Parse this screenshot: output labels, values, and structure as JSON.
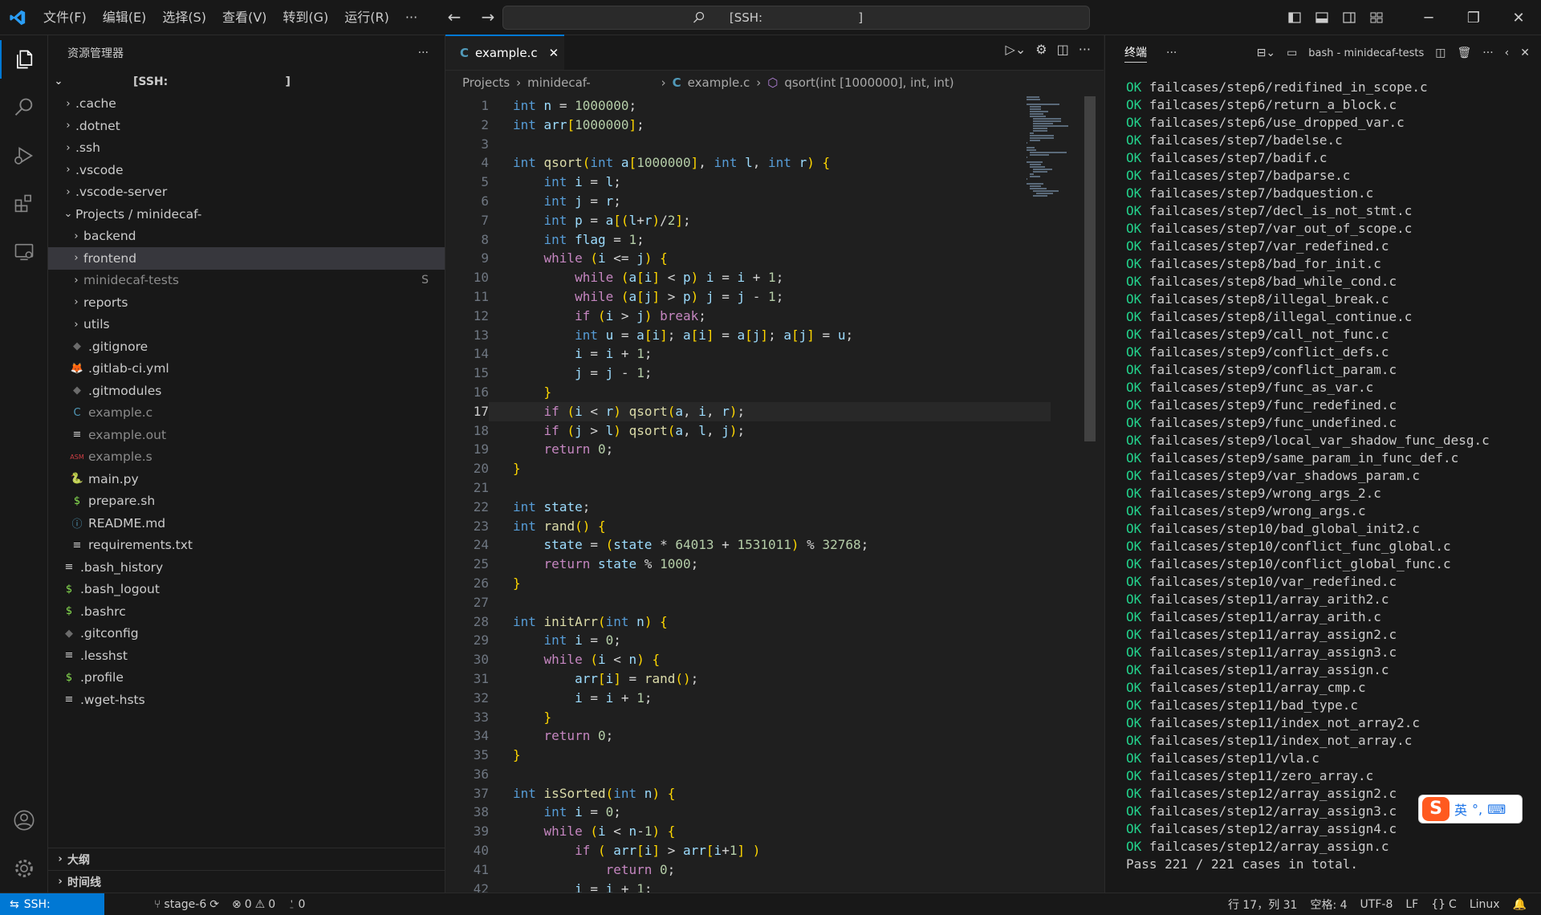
{
  "menu": [
    "文件(F)",
    "编辑(E)",
    "选择(S)",
    "查看(V)",
    "转到(G)",
    "运行(R)",
    "···"
  ],
  "command_center": "[SSH:                         ]",
  "sidebar": {
    "title": "资源管理器",
    "root": "[SSH:                              ]",
    "items": [
      {
        "label": ".cache",
        "kind": "folder",
        "depth": 1
      },
      {
        "label": ".dotnet",
        "kind": "folder",
        "depth": 1
      },
      {
        "label": ".ssh",
        "kind": "folder",
        "depth": 1
      },
      {
        "label": ".vscode",
        "kind": "folder",
        "depth": 1
      },
      {
        "label": ".vscode-server",
        "kind": "folder",
        "depth": 1
      },
      {
        "label": "Projects / minidecaf-",
        "kind": "folder-open",
        "depth": 1
      },
      {
        "label": "backend",
        "kind": "folder",
        "depth": 2
      },
      {
        "label": "frontend",
        "kind": "folder",
        "depth": 2,
        "selected": true
      },
      {
        "label": "minidecaf-tests",
        "kind": "folder",
        "depth": 2,
        "dim": true,
        "badge": "S"
      },
      {
        "label": "reports",
        "kind": "folder",
        "depth": 2
      },
      {
        "label": "utils",
        "kind": "folder",
        "depth": 2
      },
      {
        "label": ".gitignore",
        "kind": "git",
        "depth": 2
      },
      {
        "label": ".gitlab-ci.yml",
        "kind": "gitlab",
        "depth": 2
      },
      {
        "label": ".gitmodules",
        "kind": "git",
        "depth": 2
      },
      {
        "label": "example.c",
        "kind": "c",
        "depth": 2,
        "dim": true
      },
      {
        "label": "example.out",
        "kind": "lines",
        "depth": 2,
        "dim": true
      },
      {
        "label": "example.s",
        "kind": "asm",
        "depth": 2,
        "dim": true
      },
      {
        "label": "main.py",
        "kind": "py",
        "depth": 2
      },
      {
        "label": "prepare.sh",
        "kind": "sh",
        "depth": 2
      },
      {
        "label": "README.md",
        "kind": "info",
        "depth": 2
      },
      {
        "label": "requirements.txt",
        "kind": "lines",
        "depth": 2
      },
      {
        "label": ".bash_history",
        "kind": "lines",
        "depth": 1
      },
      {
        "label": ".bash_logout",
        "kind": "sh",
        "depth": 1
      },
      {
        "label": ".bashrc",
        "kind": "sh",
        "depth": 1
      },
      {
        "label": ".gitconfig",
        "kind": "git",
        "depth": 1
      },
      {
        "label": ".lesshst",
        "kind": "lines",
        "depth": 1
      },
      {
        "label": ".profile",
        "kind": "sh",
        "depth": 1
      },
      {
        "label": ".wget-hsts",
        "kind": "lines",
        "depth": 1
      }
    ],
    "sections": [
      "大纲",
      "时间线"
    ]
  },
  "editor": {
    "tab": "example.c",
    "breadcrumb": [
      "Projects",
      "minidecaf-",
      "example.c",
      "qsort(int [1000000], int, int)"
    ],
    "current_line": 17,
    "lines": [
      "int n = 1000000;",
      "int arr[1000000];",
      "",
      "int qsort(int a[1000000], int l, int r) {",
      "    int i = l;",
      "    int j = r;",
      "    int p = a[(l+r)/2];",
      "    int flag = 1;",
      "    while (i <= j) {",
      "        while (a[i] < p) i = i + 1;",
      "        while (a[j] > p) j = j - 1;",
      "        if (i > j) break;",
      "        int u = a[i]; a[i] = a[j]; a[j] = u;",
      "        i = i + 1;",
      "        j = j - 1;",
      "    }",
      "    if (i < r) qsort(a, i, r);",
      "    if (j > l) qsort(a, l, j);",
      "    return 0;",
      "}",
      "",
      "int state;",
      "int rand() {",
      "    state = (state * 64013 + 1531011) % 32768;",
      "    return state % 1000;",
      "}",
      "",
      "int initArr(int n) {",
      "    int i = 0;",
      "    while (i < n) {",
      "        arr[i] = rand();",
      "        i = i + 1;",
      "    }",
      "    return 0;",
      "}",
      "",
      "int isSorted(int n) {",
      "    int i = 0;",
      "    while (i < n-1) {",
      "        if ( arr[i] > arr[i+1] )",
      "            return 0;",
      "        i = i + 1;"
    ]
  },
  "panel": {
    "tab": "终端",
    "terminal_name": "bash - minidecaf-tests",
    "lines": [
      "failcases/step6/redifined_in_scope.c",
      "failcases/step6/return_a_block.c",
      "failcases/step6/use_dropped_var.c",
      "failcases/step7/badelse.c",
      "failcases/step7/badif.c",
      "failcases/step7/badparse.c",
      "failcases/step7/badquestion.c",
      "failcases/step7/decl_is_not_stmt.c",
      "failcases/step7/var_out_of_scope.c",
      "failcases/step7/var_redefined.c",
      "failcases/step8/bad_for_init.c",
      "failcases/step8/bad_while_cond.c",
      "failcases/step8/illegal_break.c",
      "failcases/step8/illegal_continue.c",
      "failcases/step9/call_not_func.c",
      "failcases/step9/conflict_defs.c",
      "failcases/step9/conflict_param.c",
      "failcases/step9/func_as_var.c",
      "failcases/step9/func_redefined.c",
      "failcases/step9/func_undefined.c",
      "failcases/step9/local_var_shadow_func_desg.c",
      "failcases/step9/same_param_in_func_def.c",
      "failcases/step9/var_shadows_param.c",
      "failcases/step9/wrong_args_2.c",
      "failcases/step9/wrong_args.c",
      "failcases/step10/bad_global_init2.c",
      "failcases/step10/conflict_func_global.c",
      "failcases/step10/conflict_global_func.c",
      "failcases/step10/var_redefined.c",
      "failcases/step11/array_arith2.c",
      "failcases/step11/array_arith.c",
      "failcases/step11/array_assign2.c",
      "failcases/step11/array_assign3.c",
      "failcases/step11/array_assign.c",
      "failcases/step11/array_cmp.c",
      "failcases/step11/bad_type.c",
      "failcases/step11/index_not_array2.c",
      "failcases/step11/index_not_array.c",
      "failcases/step11/vla.c",
      "failcases/step11/zero_array.c",
      "failcases/step12/array_assign2.c",
      "failcases/step12/array_assign3.c",
      "failcases/step12/array_assign4.c",
      "failcases/step12/array_assign.c"
    ],
    "ok_label": "OK",
    "summary": "Pass 221 / 221 cases in total."
  },
  "ime": {
    "label": "英",
    "punct": "°,"
  },
  "status": {
    "remote": "SSH:",
    "branch": "stage-6",
    "errors": "0",
    "warnings": "0",
    "ports": "0",
    "position": "行 17，列 31",
    "spaces": "空格: 4",
    "encoding": "UTF-8",
    "eol": "LF",
    "language": "C",
    "platform": "Linux"
  },
  "colors": {
    "accent": "#0078d4",
    "terminal_ok": "#23d18b"
  }
}
